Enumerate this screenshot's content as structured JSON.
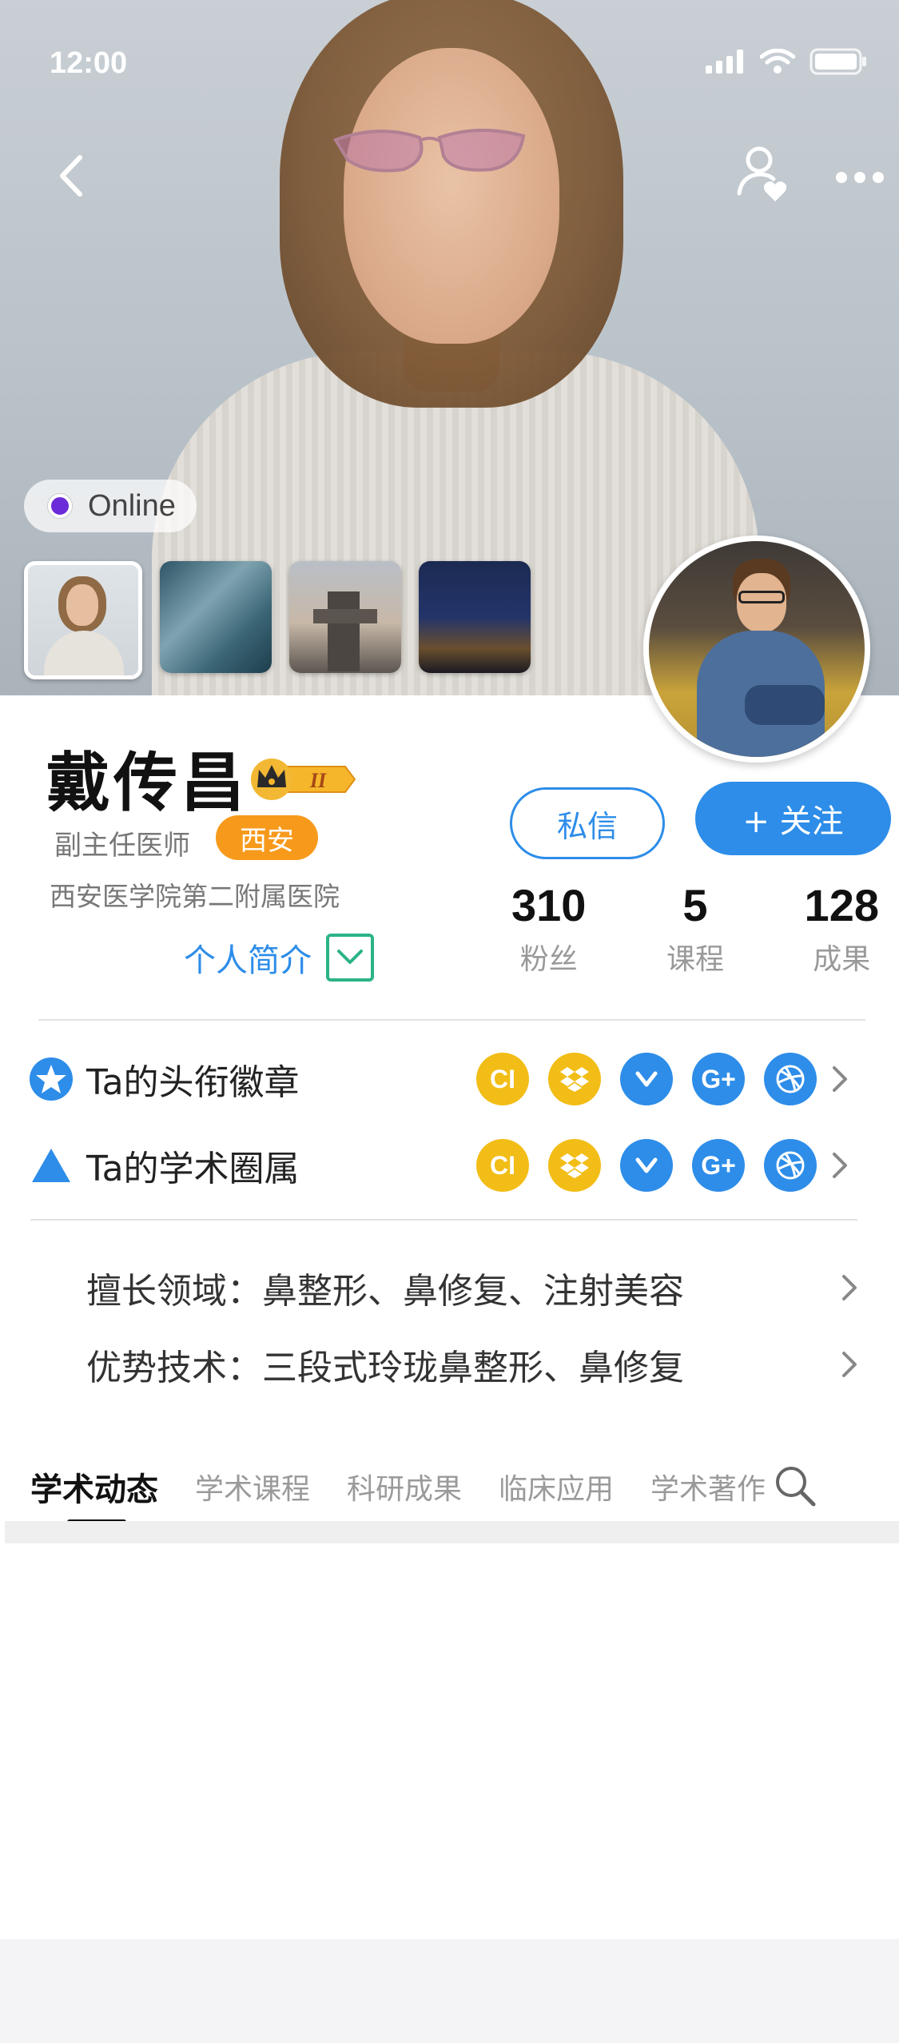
{
  "status_bar": {
    "time": "12:00"
  },
  "cover": {
    "online_label": "Online",
    "thumbnail_count": 4
  },
  "profile": {
    "name": "戴传昌",
    "level_badge": "II",
    "role": "副主任医师",
    "city": "西安",
    "hospital": "西安医学院第二附属医院",
    "intro_label": "个人简介"
  },
  "actions": {
    "message_label": "私信",
    "follow_label": "+ 关注"
  },
  "stats": [
    {
      "value": "310",
      "label": "粉丝"
    },
    {
      "value": "5",
      "label": "课程"
    },
    {
      "value": "128",
      "label": "成果"
    }
  ],
  "badges_row": {
    "title": "Ta的头衔徽章",
    "icons": [
      {
        "name": "ci-icon",
        "text": "CI",
        "color": "#f2bd16"
      },
      {
        "name": "dropbox-icon",
        "text": "",
        "color": "#f2bd16"
      },
      {
        "name": "vine-icon",
        "text": "",
        "color": "#2d8de9"
      },
      {
        "name": "google-plus-icon",
        "text": "G+",
        "color": "#2d8de9"
      },
      {
        "name": "dribbble-icon",
        "text": "",
        "color": "#2d8de9"
      }
    ]
  },
  "circles_row": {
    "title": "Ta的学术圈属",
    "icons": [
      {
        "name": "ci-icon",
        "text": "CI",
        "color": "#f2bd16"
      },
      {
        "name": "dropbox-icon",
        "text": "",
        "color": "#f2bd16"
      },
      {
        "name": "vine-icon",
        "text": "",
        "color": "#2d8de9"
      },
      {
        "name": "google-plus-icon",
        "text": "G+",
        "color": "#2d8de9"
      },
      {
        "name": "dribbble-icon",
        "text": "",
        "color": "#2d8de9"
      }
    ]
  },
  "expertise": {
    "specialty": "擅长领域：鼻整形、鼻修复、注射美容",
    "technique": "优势技术：三段式玲珑鼻整形、鼻修复"
  },
  "tabs": [
    "学术动态",
    "学术课程",
    "科研成果",
    "临床应用",
    "学术著作"
  ],
  "colors": {
    "accent": "#2d8de9",
    "city_tag": "#f79a1c",
    "intro_box": "#2bb388"
  }
}
